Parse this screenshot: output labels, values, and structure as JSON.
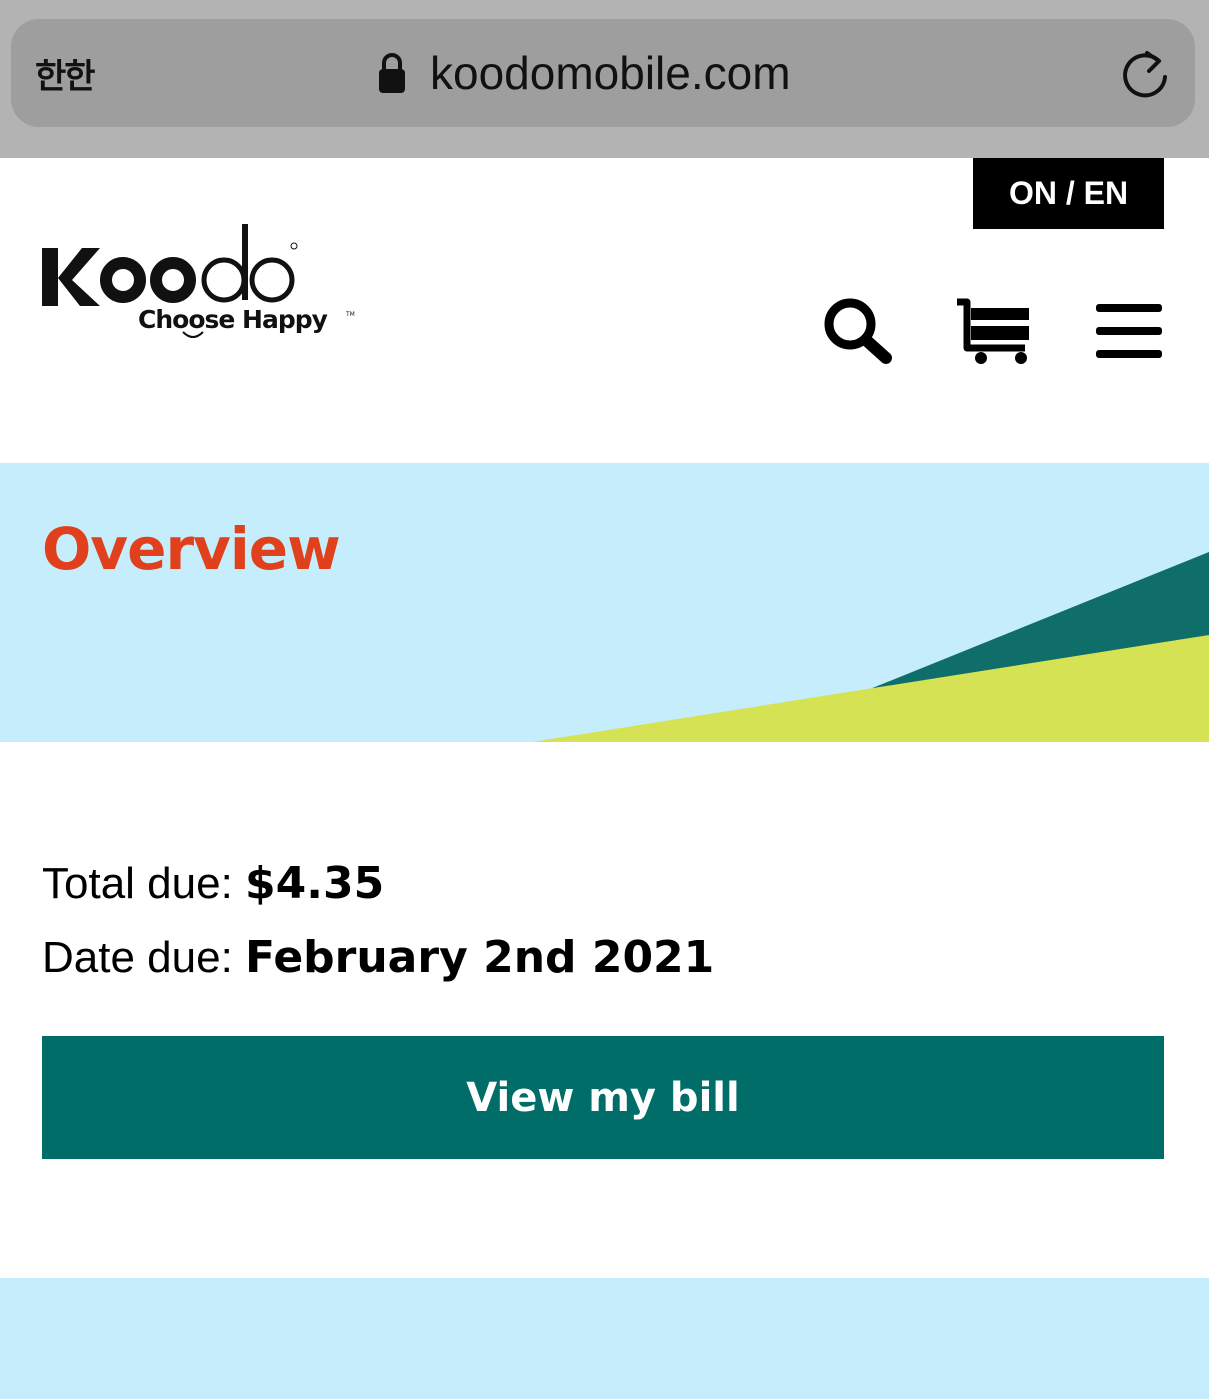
{
  "browser": {
    "reader_label": "한한",
    "url": "koodomobile.com"
  },
  "header": {
    "lang_label": "ON / EN",
    "logo_text": "Koodo",
    "logo_tagline": "Choose Happy"
  },
  "hero": {
    "title": "Overview",
    "colors": {
      "background": "#c5edfb",
      "dark_teal": "#0f6e69",
      "lime": "#d4e253",
      "title": "#e0401c"
    }
  },
  "bill": {
    "total_label": "Total due:",
    "total_value": "$4.35",
    "date_label": "Date due:",
    "date_value": "February 2nd 2021",
    "view_bill_label": "View my bill"
  },
  "icons": [
    "lock-icon",
    "reload-icon",
    "search-icon",
    "cart-icon",
    "menu-icon"
  ]
}
